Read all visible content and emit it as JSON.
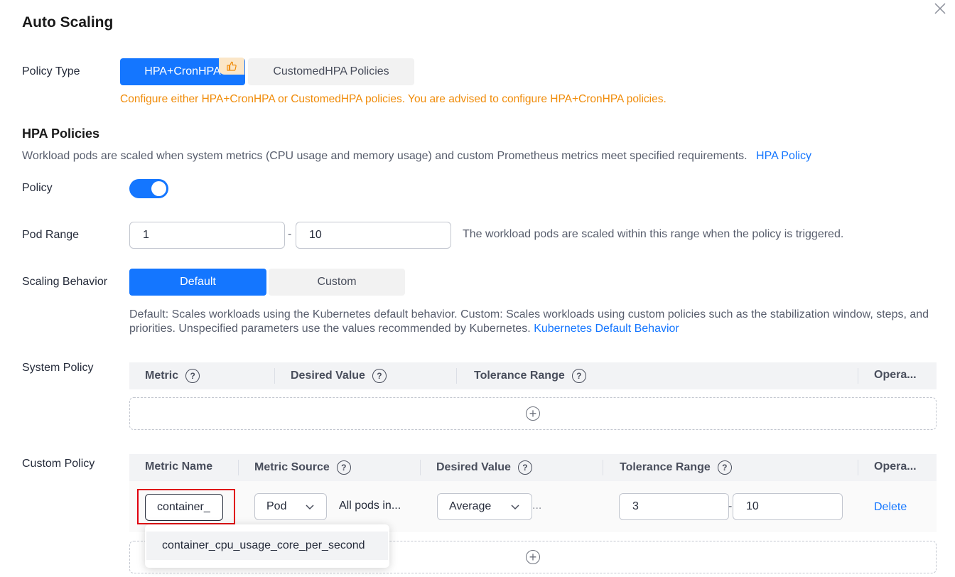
{
  "dialog": {
    "title": "Auto Scaling",
    "close_icon": "close-icon"
  },
  "policy_type": {
    "label": "Policy Type",
    "options": [
      "HPA+CronHPA",
      "CustomedHPA Policies"
    ],
    "selected": "HPA+CronHPA",
    "recommended_icon": "thumbs-up-icon",
    "warning": "Configure either HPA+CronHPA or CustomedHPA policies. You are advised to configure HPA+CronHPA policies."
  },
  "hpa": {
    "section_title": "HPA Policies",
    "description": "Workload pods are scaled when system metrics (CPU usage and memory usage) and custom Prometheus metrics meet specified requirements.",
    "description_link": "HPA Policy",
    "policy_label": "Policy",
    "policy_enabled": true,
    "pod_range": {
      "label": "Pod Range",
      "min": "1",
      "separator": "-",
      "max": "10",
      "hint": "The workload pods are scaled within this range when the policy is triggered."
    },
    "scaling_behavior": {
      "label": "Scaling Behavior",
      "options": [
        "Default",
        "Custom"
      ],
      "selected": "Default",
      "description": "Default: Scales workloads using the Kubernetes default behavior. Custom: Scales workloads using custom policies such as the stabilization window, steps, and priorities. Unspecified parameters use the values recommended by Kubernetes.",
      "description_link": "Kubernetes Default Behavior"
    },
    "system_policy": {
      "label": "System Policy",
      "columns": [
        "Metric",
        "Desired Value",
        "Tolerance Range",
        "Opera..."
      ]
    },
    "custom_policy": {
      "label": "Custom Policy",
      "columns": [
        "Metric Name",
        "Metric Source",
        "Desired Value",
        "Tolerance Range",
        "Opera..."
      ],
      "row": {
        "metric_name": "container_",
        "metric_source": "Pod",
        "source_scope": "All pods in...",
        "desired_value_type": "Average",
        "desired_value_more": "...",
        "tolerance_min": "3",
        "tolerance_sep": "-",
        "tolerance_max": "10",
        "action": "Delete"
      },
      "suggestion": "container_cpu_usage_core_per_second"
    }
  },
  "colors": {
    "primary": "#1476ff",
    "warning": "#f08c0a",
    "highlight": "#e0000e"
  }
}
